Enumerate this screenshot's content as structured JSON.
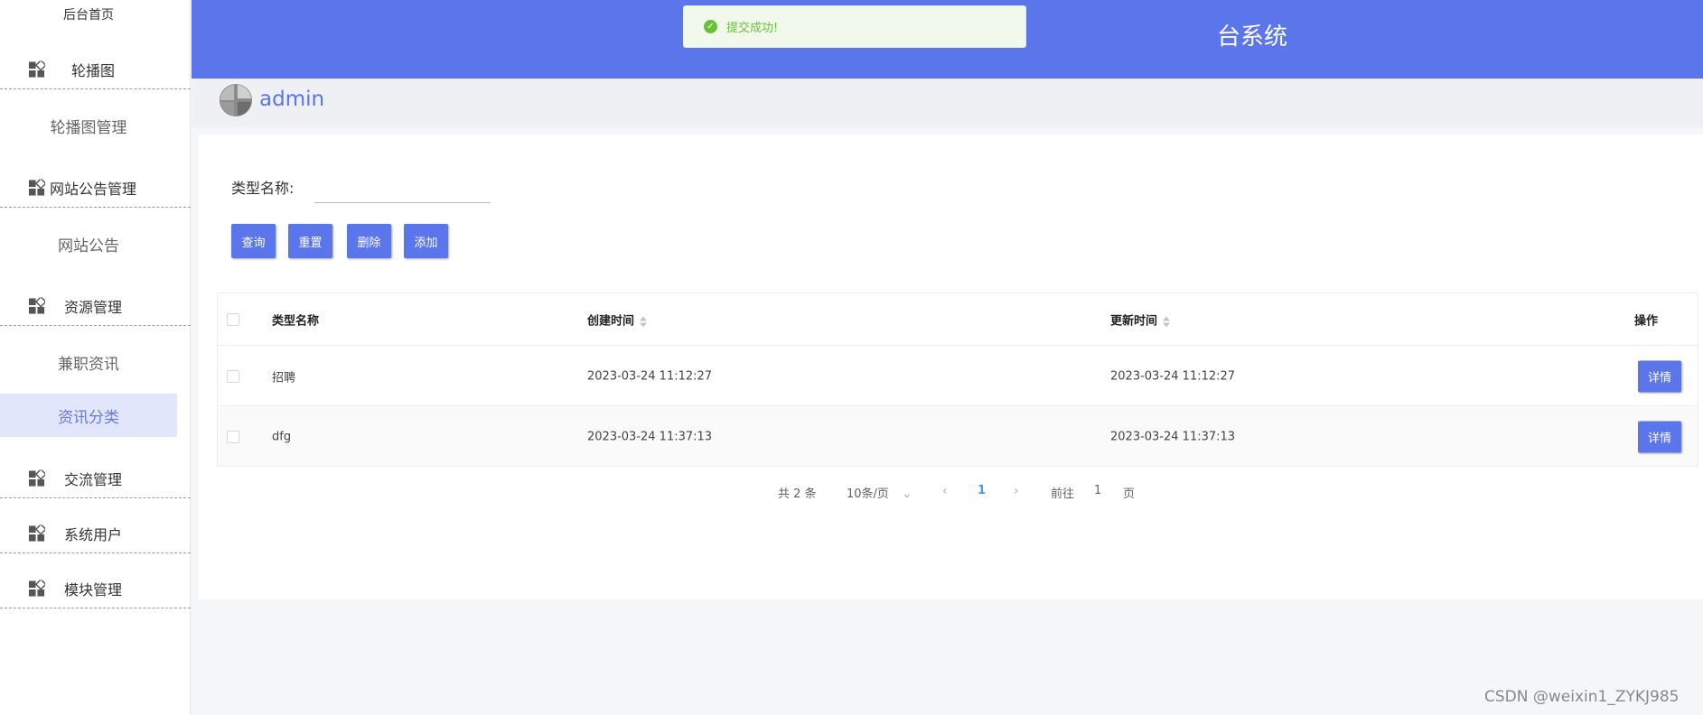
{
  "sidebar": {
    "home": "后台首页",
    "groups": [
      {
        "label": "轮播图",
        "icon": "grid-icon"
      },
      {
        "label": "网站公告管理",
        "icon": "grid-icon"
      },
      {
        "label": "资源管理",
        "icon": "grid-icon"
      },
      {
        "label": "交流管理",
        "icon": "grid-icon"
      },
      {
        "label": "系统用户",
        "icon": "grid-icon"
      },
      {
        "label": "模块管理",
        "icon": "grid-icon"
      }
    ],
    "sub_items": {
      "carousel": "轮播图管理",
      "notice": "网站公告",
      "news": "兼职资讯",
      "news_category": "资讯分类"
    },
    "active_item": "资讯分类"
  },
  "header": {
    "title": "台系统"
  },
  "toast": {
    "message": "提交成功!",
    "type": "success"
  },
  "admin": {
    "name": "admin"
  },
  "filter": {
    "label": "类型名称:",
    "value": "",
    "placeholder": ""
  },
  "toolbar": {
    "query": "查询",
    "reset": "重置",
    "delete": "删除",
    "add": "添加"
  },
  "table": {
    "columns": [
      "类型名称",
      "创建时间",
      "更新时间",
      "操作"
    ],
    "rows": [
      {
        "name": "招聘",
        "created": "2023-03-24 11:12:27",
        "updated": "2023-03-24 11:12:27",
        "action": "详情"
      },
      {
        "name": "dfg",
        "created": "2023-03-24 11:37:13",
        "updated": "2023-03-24 11:37:13",
        "action": "详情"
      }
    ]
  },
  "pagination": {
    "total": "共 2 条",
    "page_size": "10条/页",
    "current": "1",
    "goto_label": "前往",
    "goto_value": "1",
    "page_suffix": "页"
  },
  "watermark": "CSDN @weixin1_ZYKJ985",
  "colors": {
    "primary": "#5b75ea",
    "success": "#67c23a",
    "sidebar_active_bg": "#e1e6fb"
  }
}
